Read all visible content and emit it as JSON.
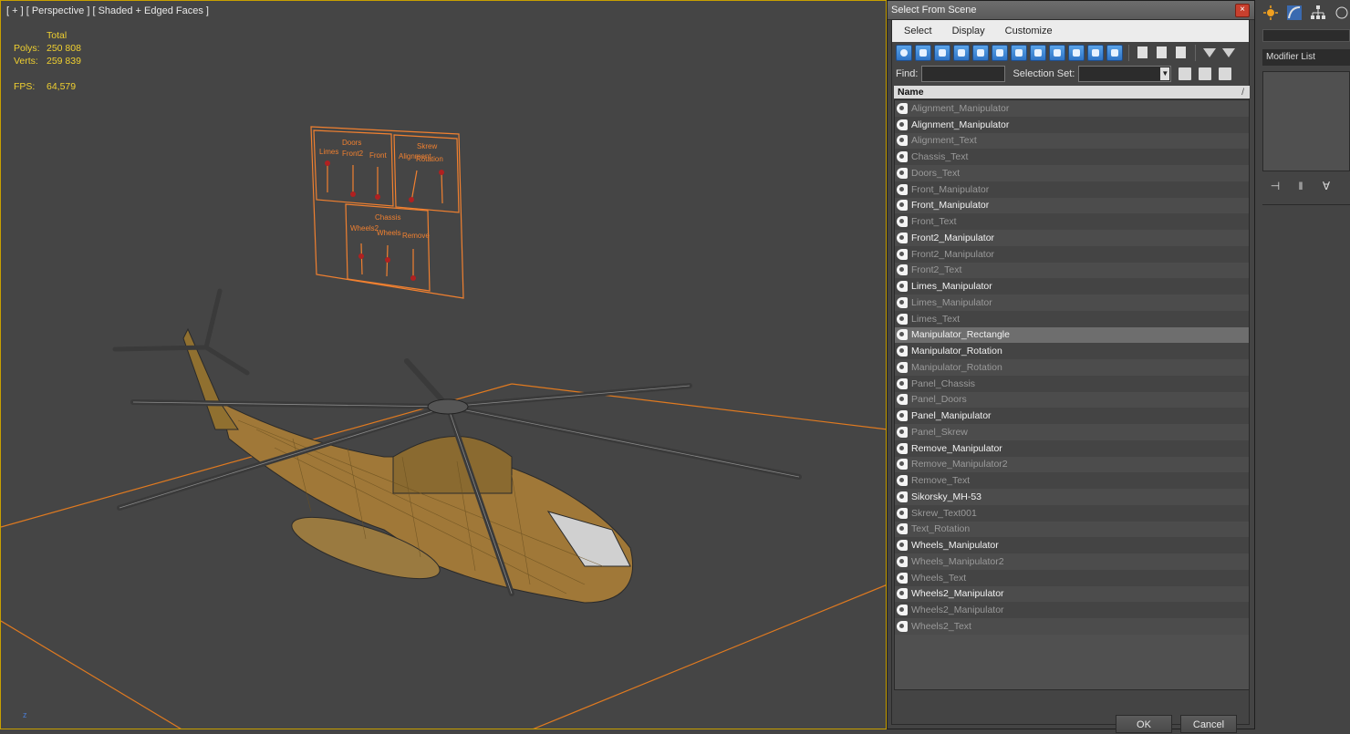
{
  "viewport": {
    "label": "[ + ] [ Perspective ] [ Shaded + Edged Faces ]",
    "stats": {
      "total_label": "Total",
      "polys_label": "Polys:",
      "polys_value": "250 808",
      "verts_label": "Verts:",
      "verts_value": "259 839",
      "fps_label": "FPS:",
      "fps_value": "64,579"
    },
    "axis_label": "z",
    "panel_text": {
      "doors": "Doors",
      "front2": "Front2",
      "front": "Front",
      "limes": "Limes",
      "skrew": "Skrew",
      "alignment": "Alignment",
      "rotation": "Rotation",
      "chassis": "Chassis",
      "remove": "Remove",
      "wheels": "Wheels",
      "wheels2": "Wheels2"
    },
    "colors": {
      "grid": "#e07a20",
      "wire": "#8a6a30",
      "panel": "#f08030"
    }
  },
  "dialog": {
    "title": "Select From Scene",
    "close": "×",
    "menu": [
      "Select",
      "Display",
      "Customize"
    ],
    "find_label": "Find:",
    "find_value": "",
    "selection_set_label": "Selection Set:",
    "column_header": "Name",
    "sort_indicator": "/",
    "items": [
      {
        "name": "Alignment_Manipulator",
        "dim": true
      },
      {
        "name": "Alignment_Manipulator",
        "dim": false
      },
      {
        "name": "Alignment_Text",
        "dim": true
      },
      {
        "name": "Chassis_Text",
        "dim": true
      },
      {
        "name": "Doors_Text",
        "dim": true
      },
      {
        "name": "Front_Manipulator",
        "dim": true
      },
      {
        "name": "Front_Manipulator",
        "dim": false
      },
      {
        "name": "Front_Text",
        "dim": true
      },
      {
        "name": "Front2_Manipulator",
        "dim": false
      },
      {
        "name": "Front2_Manipulator",
        "dim": true
      },
      {
        "name": "Front2_Text",
        "dim": true
      },
      {
        "name": "Limes_Manipulator",
        "dim": false
      },
      {
        "name": "Limes_Manipulator",
        "dim": true
      },
      {
        "name": "Limes_Text",
        "dim": true
      },
      {
        "name": "Manipulator_Rectangle",
        "dim": false,
        "highlight": true
      },
      {
        "name": "Manipulator_Rotation",
        "dim": false
      },
      {
        "name": "Manipulator_Rotation",
        "dim": true
      },
      {
        "name": "Panel_Chassis",
        "dim": true
      },
      {
        "name": "Panel_Doors",
        "dim": true
      },
      {
        "name": "Panel_Manipulator",
        "dim": false
      },
      {
        "name": "Panel_Skrew",
        "dim": true
      },
      {
        "name": "Remove_Manipulator",
        "dim": false
      },
      {
        "name": "Remove_Manipulator2",
        "dim": true
      },
      {
        "name": "Remove_Text",
        "dim": true
      },
      {
        "name": "Sikorsky_MH-53",
        "dim": false
      },
      {
        "name": "Skrew_Text001",
        "dim": true
      },
      {
        "name": "Text_Rotation",
        "dim": true
      },
      {
        "name": "Wheels_Manipulator",
        "dim": false
      },
      {
        "name": "Wheels_Manipulator2",
        "dim": true
      },
      {
        "name": "Wheels_Text",
        "dim": true
      },
      {
        "name": "Wheels2_Manipulator",
        "dim": false
      },
      {
        "name": "Wheels2_Manipulator",
        "dim": true
      },
      {
        "name": "Wheels2_Text",
        "dim": true
      }
    ],
    "ok_label": "OK",
    "cancel_label": "Cancel"
  },
  "right_panel": {
    "modifier_list_label": "Modifier List"
  }
}
